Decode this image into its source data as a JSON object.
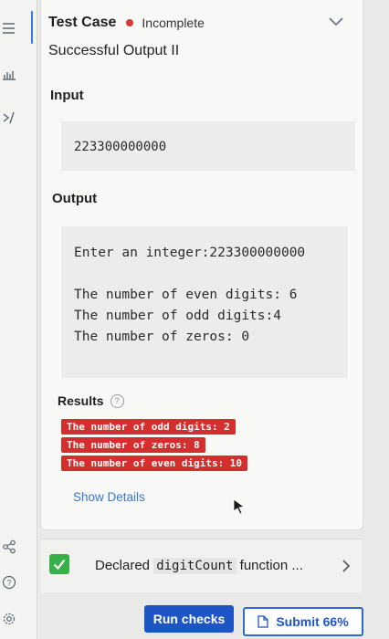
{
  "sidebar": {
    "icons": [
      "menu-icon",
      "chart-icon",
      "code-icon",
      "share-icon",
      "help-icon",
      "settings-icon"
    ]
  },
  "test_case": {
    "label": "Test Case",
    "status": "Incomplete",
    "status_color": "#d93636",
    "name": "Successful Output II"
  },
  "input": {
    "label": "Input",
    "value": "223300000000"
  },
  "output": {
    "label": "Output",
    "lines": [
      "Enter an integer:223300000000",
      "",
      "The number of even digits: 6",
      "The number of odd digits:4",
      "The number of zeros: 0"
    ]
  },
  "results": {
    "label": "Results",
    "help": "?",
    "badges": [
      "The number of odd digits: 2",
      "The number of zeros: 8",
      "The number of even digits: 10"
    ],
    "badge_color": "#d32f2f",
    "show_details": "Show Details"
  },
  "check": {
    "prefix": "Declared",
    "code": "digitCount",
    "suffix": "function ...",
    "passed": true
  },
  "buttons": {
    "run": "Run checks",
    "submit": "Submit 66%"
  }
}
